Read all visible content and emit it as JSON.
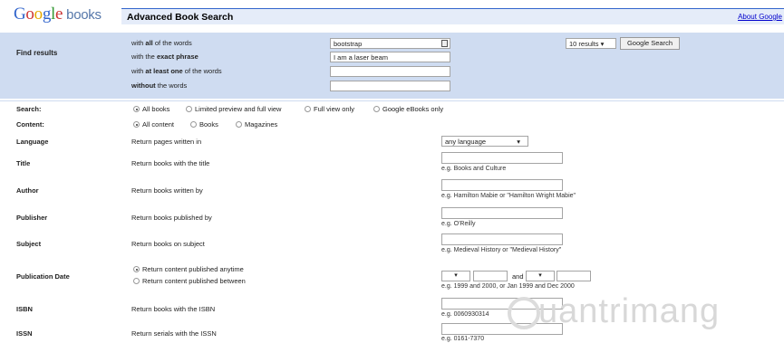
{
  "header": {
    "logo_google": [
      "G",
      "o",
      "o",
      "g",
      "l",
      "e"
    ],
    "logo_books": "books",
    "page_title": "Advanced Book Search",
    "about_link": "About Google"
  },
  "find": {
    "label": "Find results",
    "rows": [
      {
        "pre": "with ",
        "bold": "all",
        "post": " of the words",
        "value": "bootstrap"
      },
      {
        "pre": "with the ",
        "bold": "exact phrase",
        "post": "",
        "value": "I am a laser beam"
      },
      {
        "pre": "with ",
        "bold": "at least one",
        "post": " of the words",
        "value": ""
      },
      {
        "pre": "",
        "bold": "without",
        "post": " the words",
        "value": ""
      }
    ],
    "results_select": "10 results",
    "search_button": "Google Search"
  },
  "search": {
    "label": "Search:",
    "options": [
      "All books",
      "Limited preview and full view",
      "Full view only",
      "Google eBooks only"
    ]
  },
  "content": {
    "label": "Content:",
    "options": [
      "All content",
      "Books",
      "Magazines"
    ]
  },
  "language": {
    "label": "Language",
    "desc": "Return pages written in",
    "select": "any language"
  },
  "title": {
    "label": "Title",
    "desc": "Return books with the title",
    "hint": "e.g. Books and Culture"
  },
  "author": {
    "label": "Author",
    "desc": "Return books written by",
    "hint": "e.g. Hamilton Mabie or \"Hamilton Wright Mabie\""
  },
  "publisher": {
    "label": "Publisher",
    "desc": "Return books published by",
    "hint": "e.g. O'Reilly"
  },
  "subject": {
    "label": "Subject",
    "desc": "Return books on subject",
    "hint": "e.g. Medieval History or \"Medieval History\""
  },
  "pubdate": {
    "label": "Publication Date",
    "options": [
      "Return content published anytime",
      "Return content published between"
    ],
    "and": "and",
    "hint": "e.g. 1999 and 2000, or Jan 1999 and Dec 2000"
  },
  "isbn": {
    "label": "ISBN",
    "desc": "Return books with the ISBN",
    "hint": "e.g. 0060930314"
  },
  "issn": {
    "label": "ISSN",
    "desc": "Return serials with the ISSN",
    "hint": "e.g. 0161-7370"
  },
  "watermark": "uantrimang"
}
